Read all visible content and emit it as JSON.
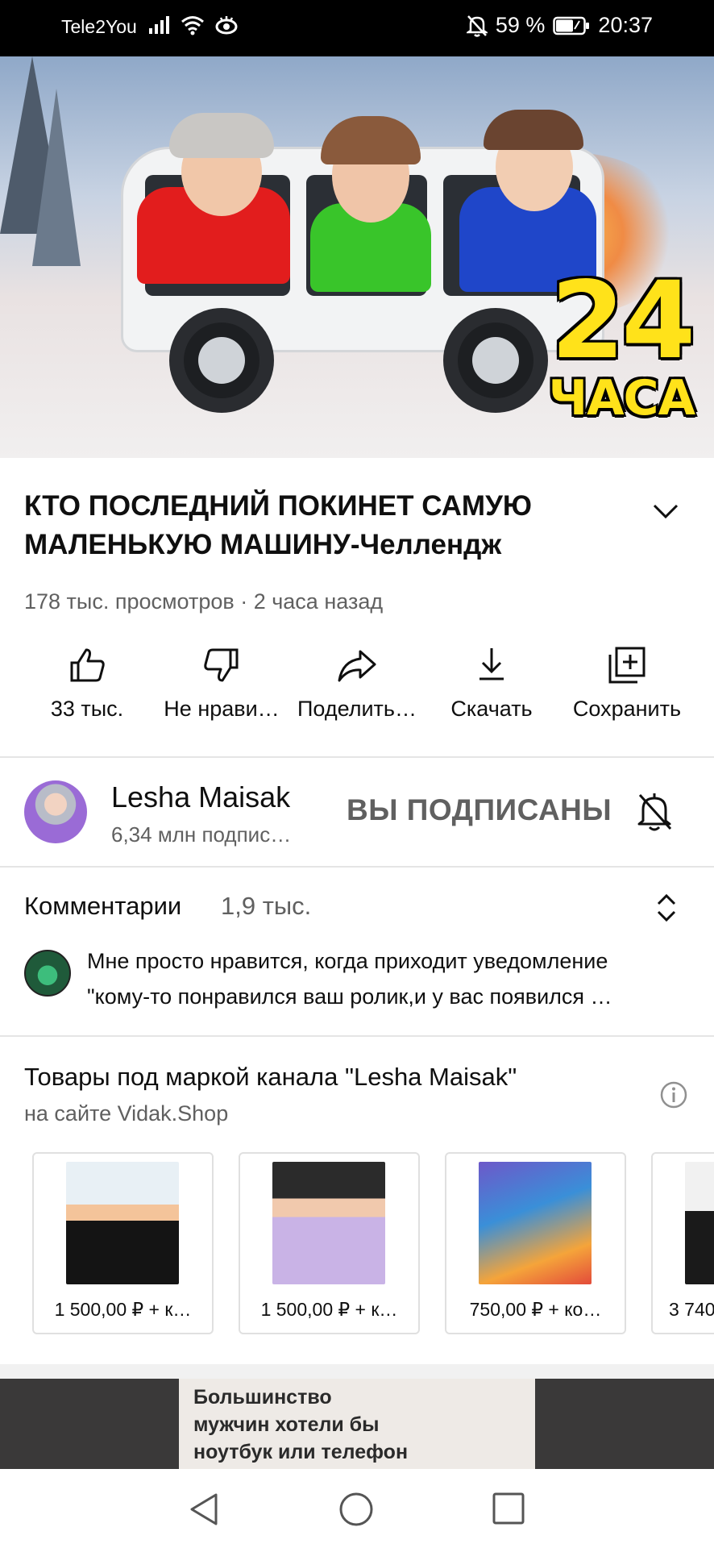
{
  "status_bar": {
    "carrier": "Tele2You",
    "battery": "59 %",
    "time": "20:37",
    "icons": [
      "signal-icon",
      "wifi-icon",
      "eye-icon",
      "bell-off-icon",
      "battery-icon"
    ]
  },
  "video": {
    "thumbnail_text_number": "24",
    "thumbnail_text_word": "ЧАСА",
    "progress_fraction": 0.04,
    "accent_color": "#ff0000"
  },
  "title": {
    "line1": "КТО ПОСЛЕДНИЙ ПОКИНЕТ САМУЮ",
    "line2": "МАЛЕНЬКУЮ МАШИНУ-Челлендж"
  },
  "meta": "178 тыс. просмотров · 2 часа назад",
  "actions": {
    "like": "33 тыс.",
    "dislike": "Не нрави…",
    "share": "Поделить…",
    "download": "Скачать",
    "save": "Сохранить"
  },
  "channel": {
    "name": "Lesha Maisak",
    "subscribers": "6,34 млн подпис…",
    "subscribed_label": "ВЫ ПОДПИСАНЫ"
  },
  "comments": {
    "header": "Комментарии",
    "count": "1,9 тыс.",
    "top_comment_line1": "Мне просто нравится, когда приходит уведомление",
    "top_comment_line2": "\"кому-то понравился ваш ролик,и у вас появился …"
  },
  "merch": {
    "title": "Товары под маркой канала \"Lesha Maisak\"",
    "subtitle": "на сайте Vidak.Shop",
    "items": [
      {
        "price": "1 500,00 ₽",
        "suffix": "+ к…"
      },
      {
        "price": "1 500,00 ₽",
        "suffix": "+ к…"
      },
      {
        "price": "750,00 ₽",
        "suffix": "+ ко…"
      },
      {
        "price": "3 740",
        "suffix": ""
      }
    ]
  },
  "ad": {
    "line1": "Большинство",
    "line2": "мужчин хотели бы",
    "line3": "ноутбук или телефон"
  }
}
